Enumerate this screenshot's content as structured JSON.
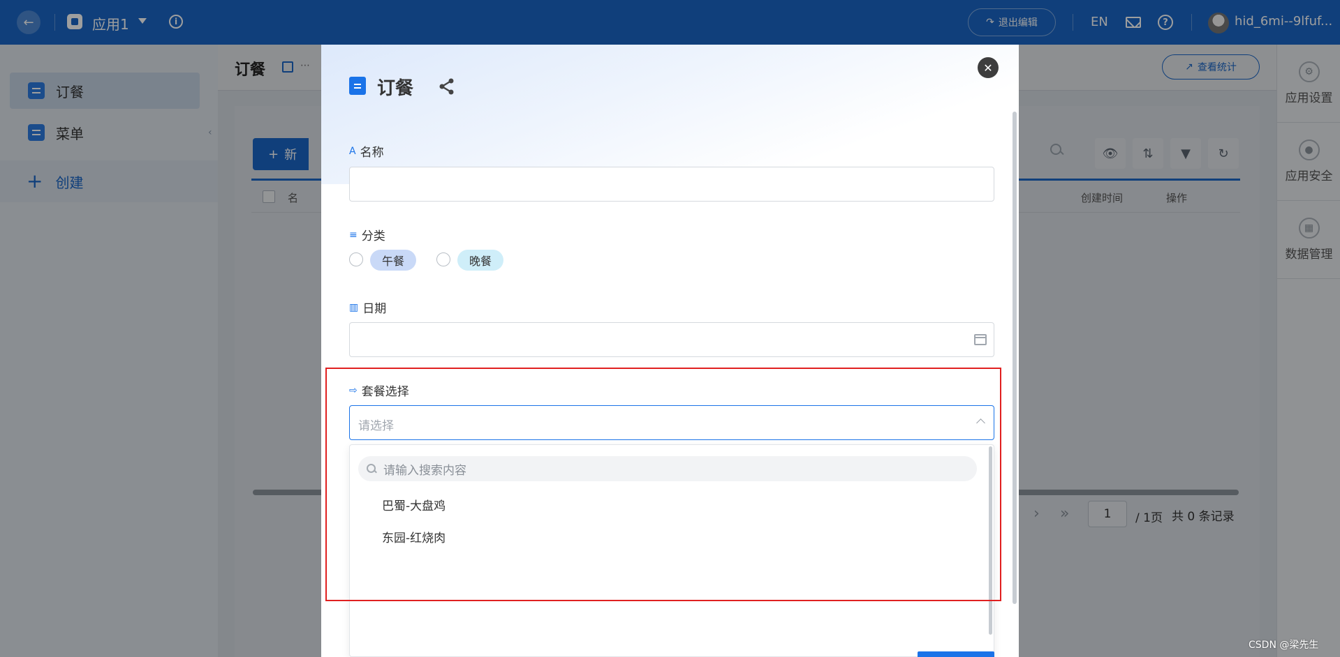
{
  "topbar": {
    "app_name": "应用1",
    "exit_label": "退出编辑",
    "lang": "EN",
    "username": "hid_6mi--9lfuf..."
  },
  "sidebar": {
    "items": [
      {
        "label": "订餐",
        "active": true
      },
      {
        "label": "菜单",
        "active": false
      }
    ],
    "create_label": "创建"
  },
  "main": {
    "title": "订餐",
    "stats_label": "查看统计",
    "new_label": "新",
    "columns": {
      "name": "名",
      "created": "创建时间",
      "action": "操作"
    },
    "pager": {
      "page": "1",
      "total_pages": "/ 1页",
      "records": "共 0 条记录"
    }
  },
  "right_rail": {
    "items": [
      "应用设置",
      "应用安全",
      "数据管理"
    ]
  },
  "modal": {
    "title": "订餐",
    "fields": {
      "name_label": "名称",
      "category_label": "分类",
      "category_options": [
        "午餐",
        "晚餐"
      ],
      "date_label": "日期",
      "combo_label": "套餐选择",
      "combo_placeholder": "请选择"
    },
    "dropdown": {
      "search_placeholder": "请输入搜索内容",
      "options": [
        "巴蜀-大盘鸡",
        "东园-红烧肉"
      ]
    }
  },
  "watermark": "CSDN @梁先生",
  "colors": {
    "topbar": "#1a67c7",
    "accent": "#1a73e8",
    "annotation": "#e02020"
  }
}
